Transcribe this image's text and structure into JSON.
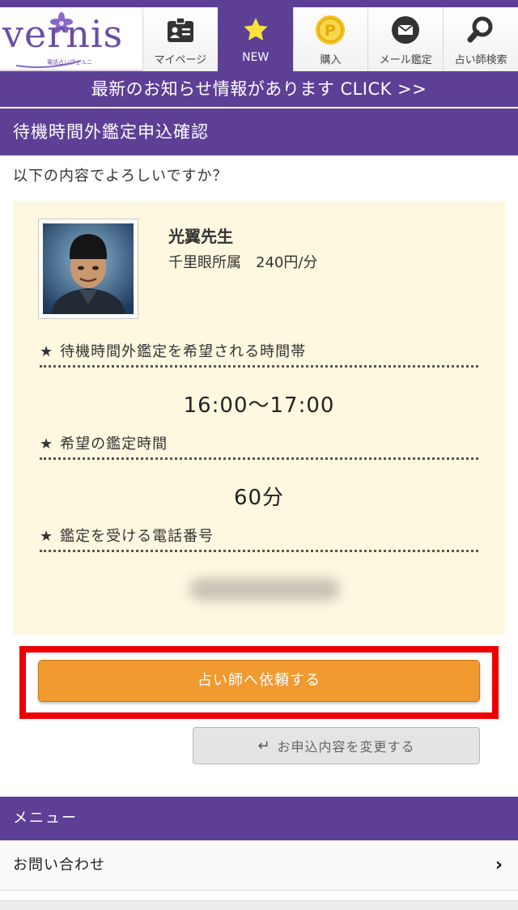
{
  "header": {
    "logo": {
      "name": "vernis",
      "tagline": "電話占いヴェルニ"
    },
    "tabs": [
      {
        "label": "マイページ",
        "icon": "id-card-icon",
        "active": false
      },
      {
        "label": "NEW",
        "icon": "star-icon",
        "active": true
      },
      {
        "label": "購入",
        "icon": "point-coin-icon",
        "active": false
      },
      {
        "label": "メール鑑定",
        "icon": "mail-icon",
        "active": false
      },
      {
        "label": "占い師検索",
        "icon": "search-icon",
        "active": false
      }
    ]
  },
  "banner": {
    "text": "最新のお知らせ情報があります CLICK >>"
  },
  "page": {
    "title": "待機時間外鑑定申込確認",
    "question": "以下の内容でよろしいですか？"
  },
  "fortune_teller": {
    "name": "光翼先生",
    "affiliation": "千里眼所属　240円/分"
  },
  "sections": [
    {
      "star": "★",
      "heading": "待機時間外鑑定を希望される時間帯",
      "value": "16:00〜17:00"
    },
    {
      "star": "★",
      "heading": "希望の鑑定時間",
      "value": "60分"
    },
    {
      "star": "★",
      "heading": "鑑定を受ける電話番号",
      "value": ""
    }
  ],
  "actions": {
    "primary_label": "占い師へ依頼する",
    "secondary_label": "お申込内容を変更する",
    "secondary_icon": "↵"
  },
  "menu": {
    "heading": "メニュー",
    "items": [
      {
        "label": "お問い合わせ",
        "chevron": "›"
      }
    ]
  },
  "colors": {
    "brand_purple": "#5d3f96",
    "card_bg": "#fff8e0",
    "primary_button": "#f09a30",
    "highlight": "#ee0000"
  }
}
